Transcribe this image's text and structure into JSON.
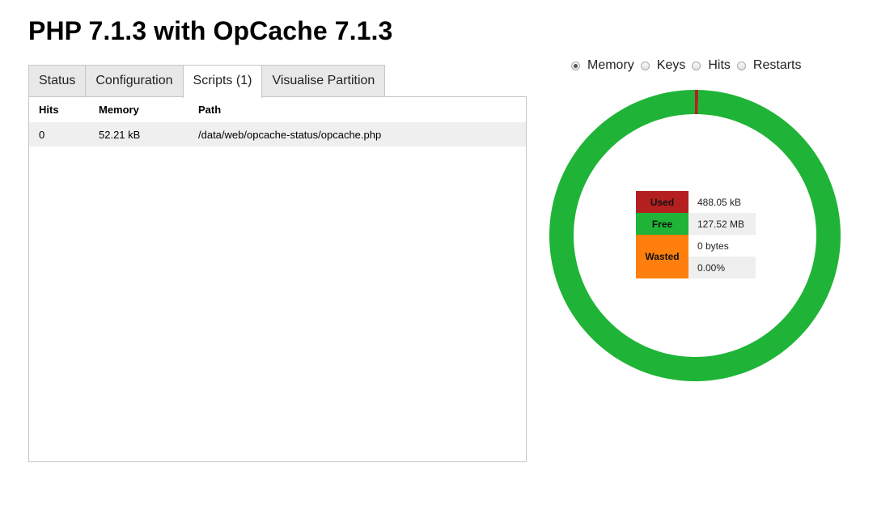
{
  "page": {
    "title": "PHP 7.1.3 with OpCache 7.1.3"
  },
  "tabs": [
    {
      "label": "Status",
      "active": false
    },
    {
      "label": "Configuration",
      "active": false
    },
    {
      "label": "Scripts (1)",
      "active": true
    },
    {
      "label": "Visualise Partition",
      "active": false
    }
  ],
  "scripts_table": {
    "headers": [
      "Hits",
      "Memory",
      "Path"
    ],
    "rows": [
      {
        "hits": "0",
        "memory": "52.21 kB",
        "path": "/data/web/opcache-status/opcache.php"
      }
    ]
  },
  "graph_controls": {
    "options": [
      {
        "label": "Memory",
        "checked": true
      },
      {
        "label": "Keys",
        "checked": false
      },
      {
        "label": "Hits",
        "checked": false
      },
      {
        "label": "Restarts",
        "checked": false
      }
    ]
  },
  "memory_legend": {
    "used_label": "Used",
    "used_value": "488.05 kB",
    "free_label": "Free",
    "free_value": "127.52 MB",
    "wasted_label": "Wasted",
    "wasted_value": "0 bytes",
    "wasted_percent": "0.00%"
  },
  "colors": {
    "used": "#b41f1f",
    "free": "#1fb437",
    "wasted": "#ff7f0e"
  },
  "chart_data": {
    "type": "pie",
    "categories": [
      "Used",
      "Free",
      "Wasted"
    ],
    "values": [
      0.3727,
      99.6273,
      0
    ]
  }
}
